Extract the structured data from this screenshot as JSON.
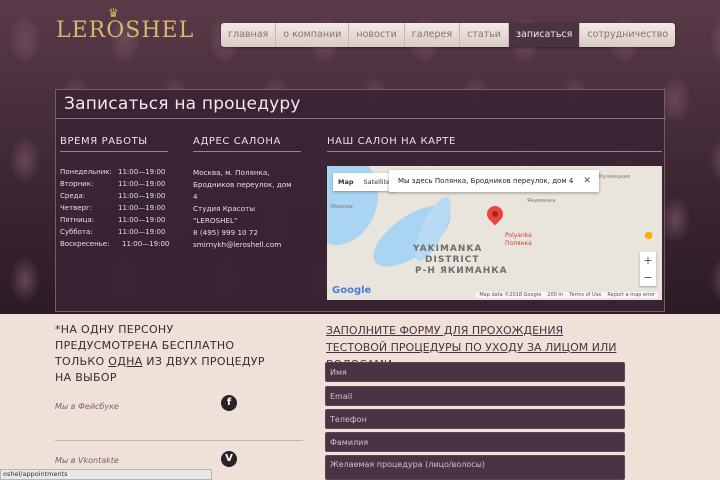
{
  "brand": {
    "logo_text": "LEROSHEL",
    "crown": "♛"
  },
  "nav": {
    "items": [
      {
        "label": "главная",
        "active": false
      },
      {
        "label": "о компании",
        "active": false
      },
      {
        "label": "новости",
        "active": false
      },
      {
        "label": "галерея",
        "active": false
      },
      {
        "label": "статьи",
        "active": false
      },
      {
        "label": "записаться",
        "active": true
      },
      {
        "label": "сотрудничество",
        "active": false
      }
    ]
  },
  "panel": {
    "title": "Записаться на процедуру",
    "hours_heading": "ВРЕМЯ РАБОТЫ",
    "address_heading": "АДРЕС САЛОНА",
    "map_heading": "НАШ САЛОН НА КАРТЕ",
    "hours": [
      {
        "day": "Понедельник:",
        "time": "11:00—19:00"
      },
      {
        "day": "Вторник:",
        "time": "11:00—19:00"
      },
      {
        "day": "Среда:",
        "time": "11:00—19:00"
      },
      {
        "day": "Четверг:",
        "time": "11:00—19:00"
      },
      {
        "day": "Пятница:",
        "time": "11:00—19:00"
      },
      {
        "day": "Суббота:",
        "time": "11:00—19:00"
      },
      {
        "day": "Воскресенье:",
        "time": "11:00—19:00"
      }
    ],
    "address_lines": [
      "Москва, м. Полянка,",
      "Бродников переулок, дом",
      "4",
      "Студия Красоты",
      "\"LEROSHEL\"",
      "8 (495) 999 10 72",
      "smirnykh@leroshell.com"
    ]
  },
  "map": {
    "type_map": "Map",
    "type_satellite": "Satellite",
    "info_text": "Мы здесь Полянка, Бродников переулок, дом 4",
    "info_close": "✕",
    "district_line1": "YAKIMANKA",
    "district_line2": "DISTRICT",
    "district_line3": "Р-Н ЯКИМАНКА",
    "metro_label": "Polyanka",
    "metro_label_ru": "Полянка",
    "street_1": "Якиманка",
    "street_2": "Moscow",
    "street_3": "Кузнецкая",
    "zoom_in": "+",
    "zoom_out": "−",
    "google": "Google",
    "footer_data": "Map data ©2018 Google",
    "footer_scale": "200 m",
    "footer_terms": "Terms of Use",
    "footer_report": "Report a map error"
  },
  "note": {
    "line_a": "*НА ОДНУ ПЕРСОНУ",
    "line_b": "ПРЕДУСМОТРЕНА БЕСПЛАТНО",
    "line_c_pre": "ТОЛЬКО ",
    "line_c_u": "ОДНА",
    "line_c_post": " ИЗ ДВУХ ПРОЦЕДУР",
    "line_d": "НА ВЫБОР"
  },
  "social": {
    "facebook_label": "Мы в Фейсбуке",
    "facebook_icon": "f",
    "vk_label": "Мы в Vkontakte",
    "vk_icon": "V"
  },
  "form": {
    "title": "ЗАПОЛНИТЕ ФОРМУ ДЛЯ ПРОХОЖДЕНИЯ ТЕСТОВОЙ ПРОЦЕДУРЫ ПО УХОДУ ЗА ЛИЦОМ ИЛИ ВОЛОСАМИ",
    "name_placeholder": "Имя",
    "email_placeholder": "Email",
    "phone_placeholder": "Телефон",
    "surname_placeholder": "Фамилия",
    "procedure_placeholder": "Желаемая процедура (лицо/волосы)"
  },
  "status_bar": {
    "text": "oshel/appointments"
  }
}
